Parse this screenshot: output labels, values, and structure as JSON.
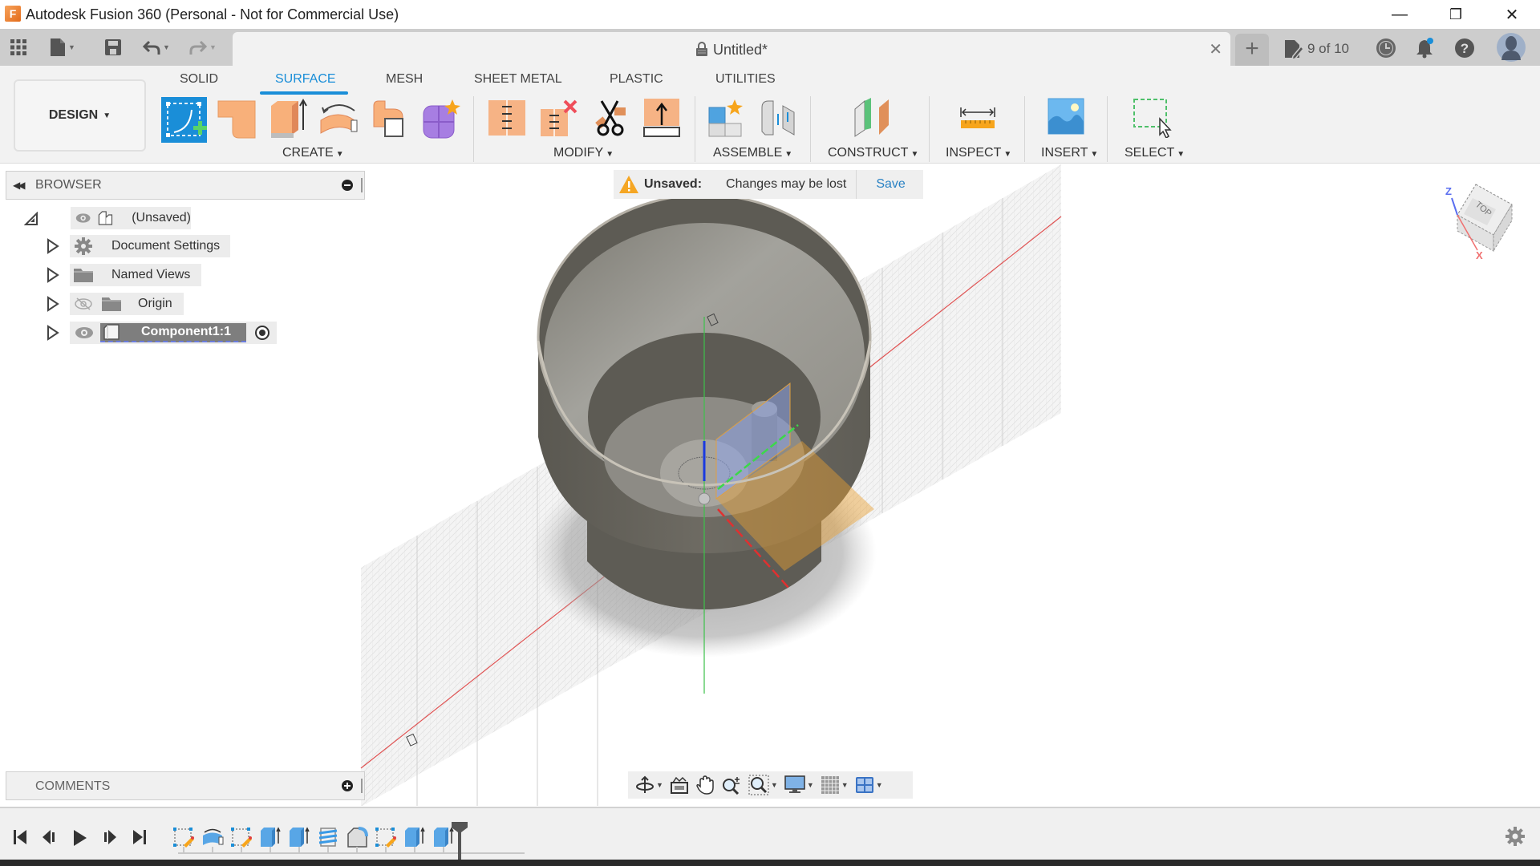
{
  "window": {
    "title": "Autodesk Fusion 360 (Personal - Not for Commercial Use)",
    "logo_letter": "F",
    "controls": {
      "minimize": "—",
      "restore": "❐",
      "close": "✕"
    }
  },
  "quick_access": {
    "icons": [
      "data-panel-grid-icon",
      "file-icon",
      "save-icon",
      "undo-icon",
      "redo-icon"
    ]
  },
  "document_tab": {
    "title": "Untitled*",
    "lock_icon": "lock-icon",
    "close": "✕",
    "new_tab": "+"
  },
  "header_right": {
    "job_status": "9 of 10",
    "icons": [
      "job-status-icon",
      "history-clock-icon",
      "notifications-bell-icon",
      "help-icon",
      "user-avatar"
    ],
    "notification_dot_color": "#1a8ed8"
  },
  "ribbon": {
    "workspace_button": "DESIGN",
    "tabs": [
      {
        "label": "SOLID",
        "active": false
      },
      {
        "label": "SURFACE",
        "active": true
      },
      {
        "label": "MESH",
        "active": false
      },
      {
        "label": "SHEET METAL",
        "active": false
      },
      {
        "label": "PLASTIC",
        "active": false
      },
      {
        "label": "UTILITIES",
        "active": false
      }
    ],
    "groups": [
      {
        "label": "CREATE",
        "tools": [
          "create-sketch",
          "patch",
          "extrude",
          "revolve",
          "offset",
          "create-form"
        ]
      },
      {
        "label": "MODIFY",
        "tools": [
          "stitch",
          "unstitch",
          "trim",
          "extend"
        ]
      },
      {
        "label": "ASSEMBLE",
        "tools": [
          "new-component",
          "joint"
        ]
      },
      {
        "label": "CONSTRUCT",
        "tools": [
          "offset-plane"
        ]
      },
      {
        "label": "INSPECT",
        "tools": [
          "measure"
        ]
      },
      {
        "label": "INSERT",
        "tools": [
          "insert-image"
        ]
      },
      {
        "label": "SELECT",
        "tools": [
          "window-select"
        ]
      }
    ],
    "accent_color": "#1a8ed8"
  },
  "browser": {
    "title": "BROWSER",
    "items": [
      {
        "label": "(Unsaved)",
        "icon": "component-icon",
        "visible": true,
        "expanded": true
      },
      {
        "label": "Document Settings",
        "icon": "gear-icon"
      },
      {
        "label": "Named Views",
        "icon": "folder-icon"
      },
      {
        "label": "Origin",
        "icon": "folder-icon",
        "visible": false
      },
      {
        "label": "Component1:1",
        "icon": "component-icon",
        "visible": true,
        "active": true
      }
    ]
  },
  "unsaved_banner": {
    "label": "Unsaved:",
    "message": "Changes may be lost",
    "action": "Save"
  },
  "viewcube": {
    "face": "TOP",
    "axes": {
      "z": "Z",
      "x": "X"
    }
  },
  "comments": {
    "title": "COMMENTS"
  },
  "nav_toolbar": {
    "tools": [
      "orbit",
      "look-at",
      "pan",
      "zoom",
      "fit",
      "display-settings",
      "grid-snaps",
      "viewports"
    ]
  },
  "timeline": {
    "controls": [
      "first",
      "previous",
      "play",
      "next",
      "last"
    ],
    "features": [
      "sketch",
      "revolve",
      "sketch",
      "extrude",
      "extrude",
      "thread",
      "fillet",
      "sketch",
      "extrude",
      "extrude"
    ]
  }
}
